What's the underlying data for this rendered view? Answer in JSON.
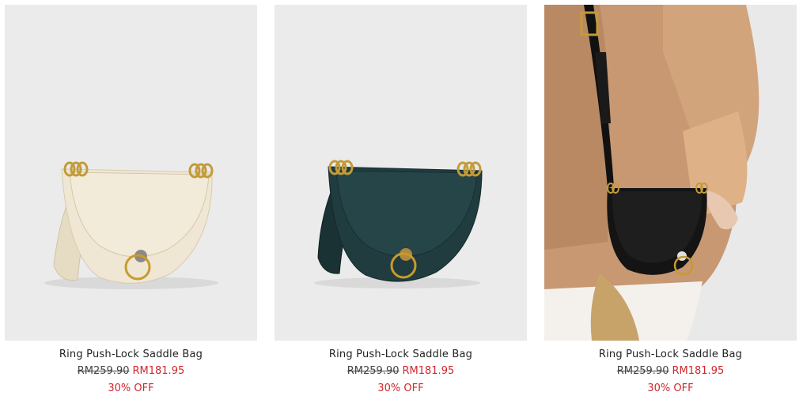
{
  "products": [
    {
      "name": "Ring Push-Lock Saddle Bag",
      "old_price": "RM259.90",
      "new_price": "RM181.95",
      "discount": "30% OFF",
      "color": "#ece4d0"
    },
    {
      "name": "Ring Push-Lock Saddle Bag",
      "old_price": "RM259.90",
      "new_price": "RM181.95",
      "discount": "30% OFF",
      "color": "#1f3a3c"
    },
    {
      "name": "Ring Push-Lock Saddle Bag",
      "old_price": "RM259.90",
      "new_price": "RM181.95",
      "discount": "30% OFF",
      "color": "#141414"
    }
  ]
}
